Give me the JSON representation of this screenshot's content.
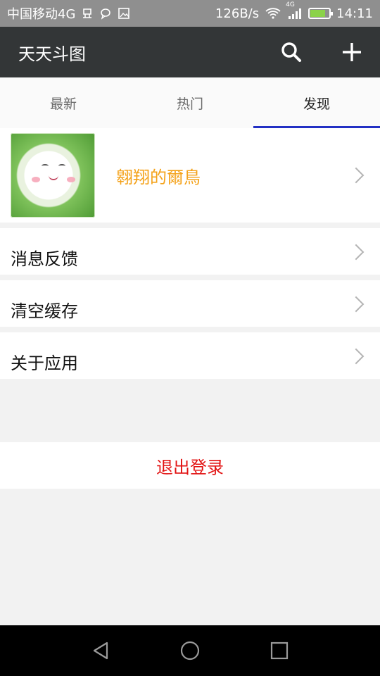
{
  "status_bar": {
    "carrier": "中国移动4G",
    "speed": "126B/s",
    "network_badge": "4G",
    "time": "14:11",
    "icons": [
      "usb-icon",
      "message-icon",
      "image-icon",
      "wifi-icon",
      "signal-icon",
      "battery-icon"
    ]
  },
  "app_bar": {
    "title": "天天斗图",
    "actions": [
      "search-icon",
      "add-icon"
    ]
  },
  "tabs": [
    {
      "label": "最新",
      "active": false
    },
    {
      "label": "热门",
      "active": false
    },
    {
      "label": "发现",
      "active": true
    }
  ],
  "profile": {
    "name": "翱翔的爾鳥",
    "name_color": "#f4a21a"
  },
  "menu": [
    {
      "label": "消息反馈"
    },
    {
      "label": "清空缓存"
    },
    {
      "label": "关于应用"
    }
  ],
  "logout": {
    "label": "退出登录",
    "color": "#e21212"
  },
  "nav_bar": {
    "buttons": [
      "back-icon",
      "home-icon",
      "recents-icon"
    ]
  },
  "colors": {
    "tab_indicator": "#2330c4",
    "app_bar": "#333637",
    "status_bar": "#8f8f8f"
  }
}
